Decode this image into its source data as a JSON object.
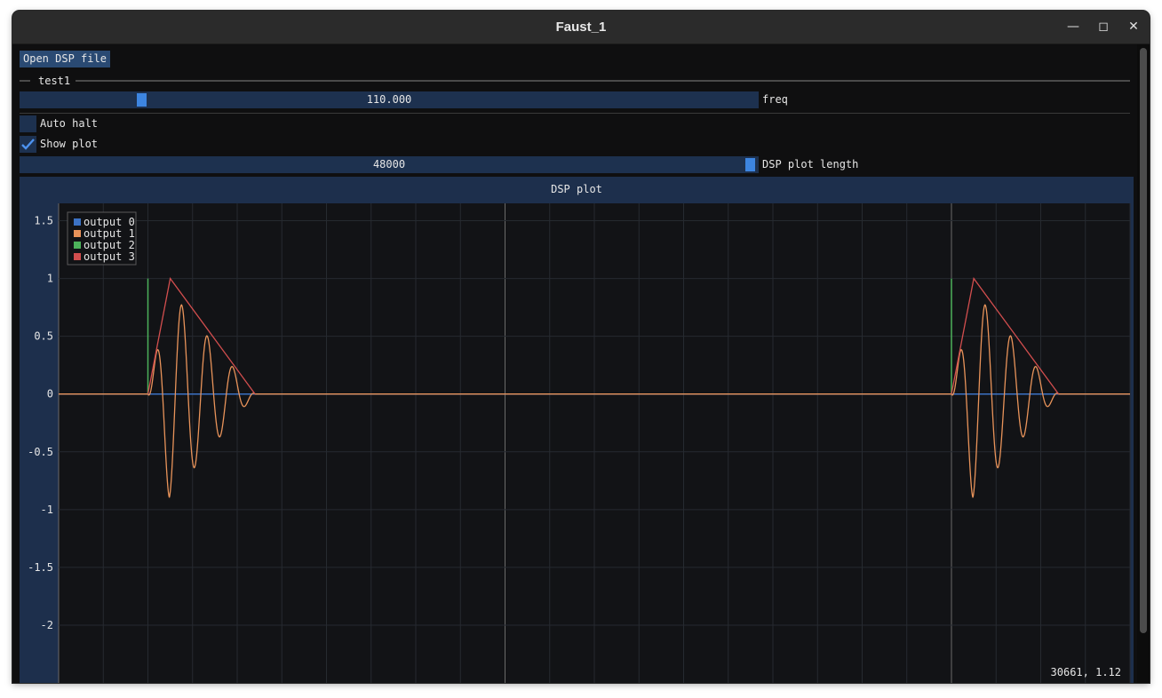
{
  "window": {
    "title": "Faust_1"
  },
  "toolbar": {
    "open_label": "Open DSP file"
  },
  "group": {
    "label": "test1"
  },
  "freq_slider": {
    "value": "110.000",
    "label": "freq",
    "fraction": 0.2
  },
  "auto_halt": {
    "label": "Auto halt",
    "checked": false
  },
  "show_plot": {
    "label": "Show plot",
    "checked": true
  },
  "plot_length_slider": {
    "value": "48000",
    "label": "DSP plot length",
    "fraction": 1.0
  },
  "status": {
    "cursor_readout": "30661, 1.12"
  },
  "chart_data": {
    "type": "line",
    "title": "DSP plot",
    "xlabel": "",
    "ylabel": "",
    "xlim": [
      0,
      48000
    ],
    "ylim": [
      -2.5,
      1.65
    ],
    "y_ticks": [
      "1.5",
      "1",
      "0.5",
      "0",
      "-0.5",
      "-1",
      "-1.5",
      "-2"
    ],
    "y_tick_values": [
      1.5,
      1,
      0.5,
      0,
      -0.5,
      -1,
      -1.5,
      -2
    ],
    "grid": true,
    "legend_position": "top-left",
    "series": [
      {
        "name": "output 0",
        "color": "#3c72c4",
        "x": [
          0,
          48000
        ],
        "y": [
          0,
          0
        ]
      },
      {
        "name": "output 1",
        "color": "#e8935a",
        "impulse_starts": [
          4000,
          40000
        ],
        "burst_length": 4800,
        "peak": 0.9,
        "cycles": 4.2
      },
      {
        "name": "output 2",
        "color": "#4cb25a",
        "impulse_x": [
          4000,
          40000
        ],
        "impulse_height": 1.0
      },
      {
        "name": "output 3",
        "color": "#d24e4e",
        "envelope_starts": [
          4000,
          40000
        ],
        "attack": 1000,
        "decay": 3800,
        "peak": 1.0
      }
    ]
  }
}
